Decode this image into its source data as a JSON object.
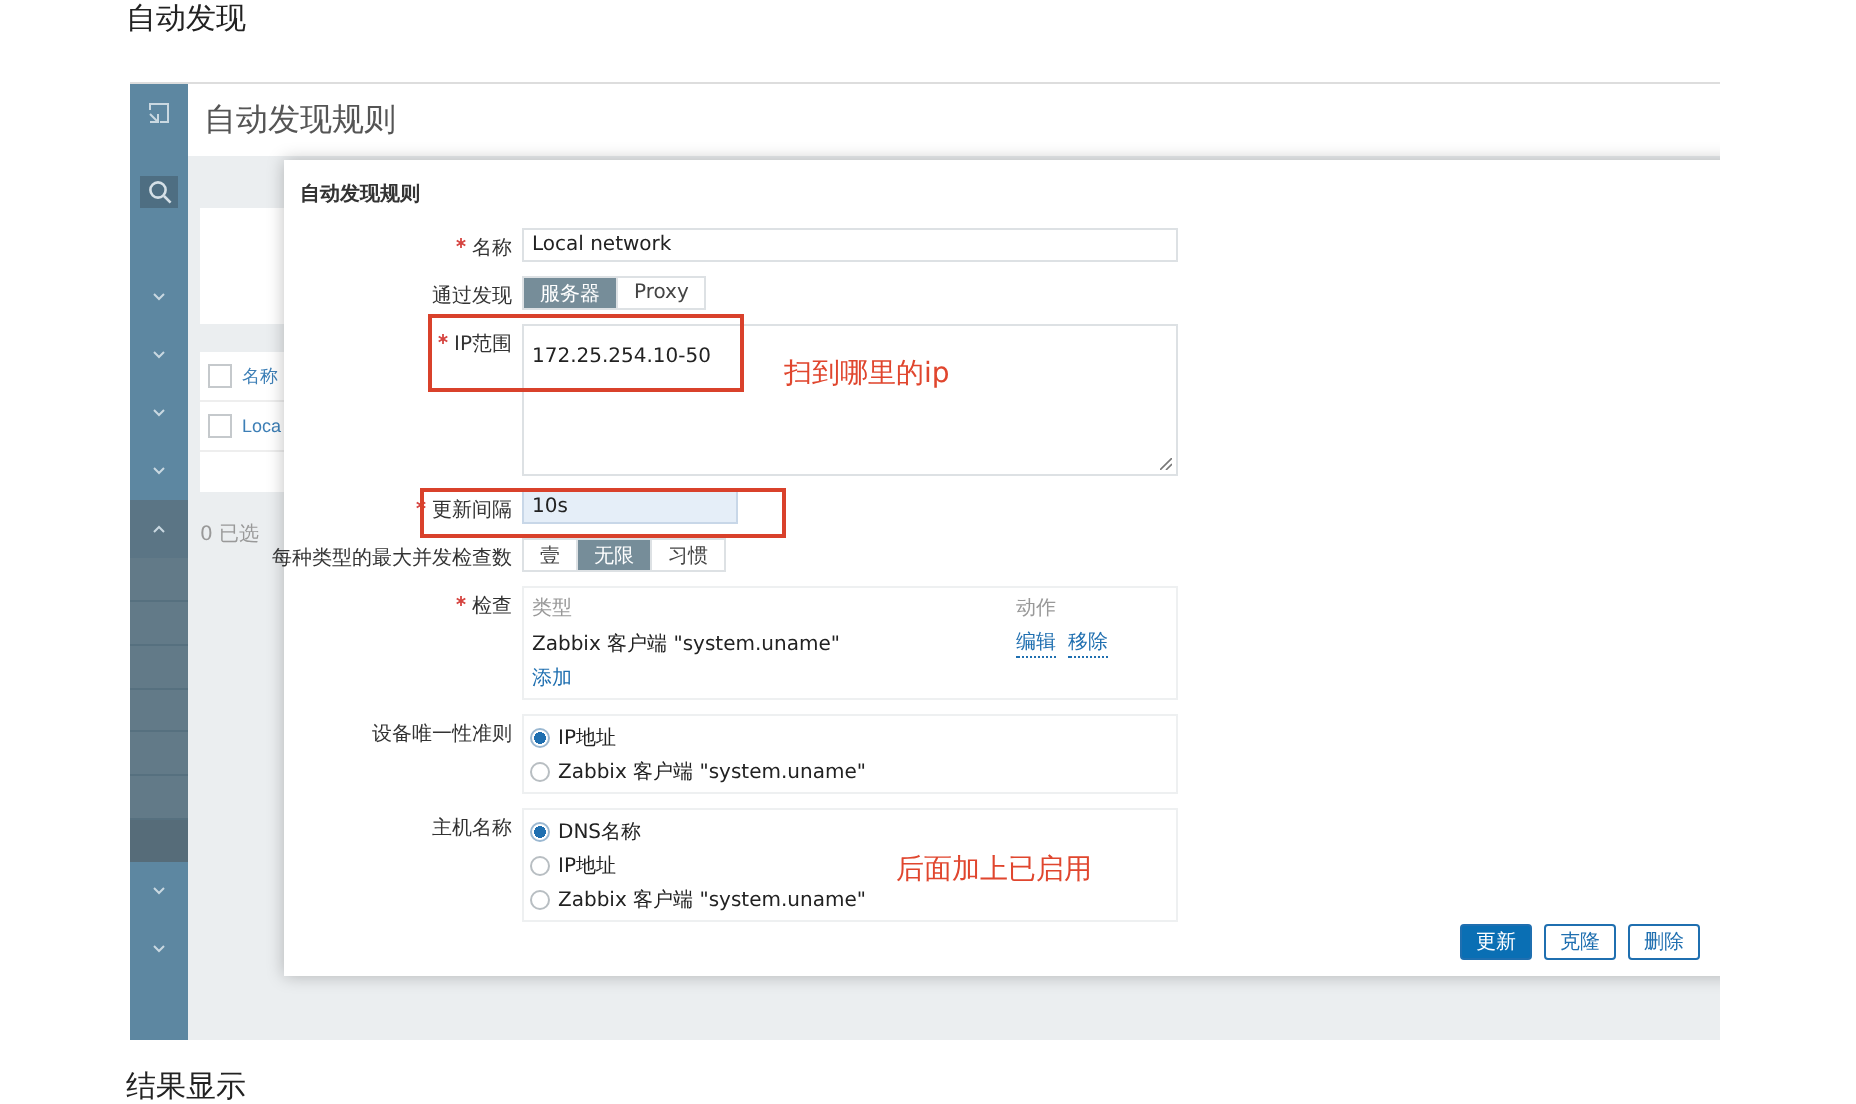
{
  "article": {
    "heading": "自动发现",
    "footer_heading": "结果显示"
  },
  "sidebar": [
    {
      "kind": "collapse"
    },
    {
      "kind": "search",
      "selected": true
    },
    {
      "kind": "menu",
      "expanded": false
    },
    {
      "kind": "menu",
      "expanded": false
    },
    {
      "kind": "menu",
      "expanded": false
    },
    {
      "kind": "menu",
      "expanded": false
    },
    {
      "kind": "menu",
      "expanded": true
    },
    {
      "kind": "menu",
      "expanded": false
    },
    {
      "kind": "menu",
      "expanded": false
    }
  ],
  "page_title": "自动发现规则",
  "background_list": {
    "header": {
      "label": "名称",
      "checked": false
    },
    "rows": [
      {
        "label": "Loca",
        "checked": false
      }
    ],
    "selected_count": "0 已选"
  },
  "dialog": {
    "title": "自动发现规则",
    "fields": [
      {
        "kind": "text",
        "label": "名称",
        "required": true,
        "value": "Local network",
        "focused": false
      },
      {
        "kind": "segmented",
        "label": "通过发现",
        "required": false,
        "options": [
          {
            "label": "服务器",
            "selected": true
          },
          {
            "label": "Proxy",
            "selected": false
          }
        ]
      },
      {
        "kind": "textarea",
        "label": "IP范围",
        "required": true,
        "value": "172.25.254.10-50"
      },
      {
        "kind": "text",
        "label": "更新间隔",
        "required": true,
        "value": "10s",
        "focused": true
      },
      {
        "kind": "segmented",
        "label": "每种类型的最大并发检查数",
        "required": false,
        "options": [
          {
            "label": "壹",
            "selected": false
          },
          {
            "label": "无限",
            "selected": true
          },
          {
            "label": "习惯",
            "selected": false
          }
        ]
      },
      {
        "kind": "checks",
        "label": "检查",
        "required": true,
        "columns": [
          "类型",
          "动作"
        ],
        "rows": [
          {
            "type": "Zabbix 客户端 \"system.uname\"",
            "actions": [
              "编辑",
              "移除"
            ]
          }
        ],
        "add": "添加"
      },
      {
        "kind": "radio",
        "label": "设备唯一性准则",
        "required": false,
        "options": [
          {
            "label": "IP地址",
            "selected": true
          },
          {
            "label": "Zabbix 客户端 \"system.uname\"",
            "selected": false
          }
        ]
      },
      {
        "kind": "radio",
        "label": "主机名称",
        "required": false,
        "options": [
          {
            "label": "DNS名称",
            "selected": true
          },
          {
            "label": "IP地址",
            "selected": false
          },
          {
            "label": "Zabbix 客户端 \"system.uname\"",
            "selected": false
          }
        ]
      }
    ],
    "buttons": [
      {
        "label": "更新",
        "primary": true
      },
      {
        "label": "克隆",
        "primary": false
      },
      {
        "label": "删除",
        "primary": false
      }
    ]
  },
  "annotations": [
    {
      "kind": "box"
    },
    {
      "kind": "text",
      "text": "扫到哪里的ip"
    },
    {
      "kind": "box"
    },
    {
      "kind": "text",
      "text": "后面加上已启用"
    }
  ]
}
